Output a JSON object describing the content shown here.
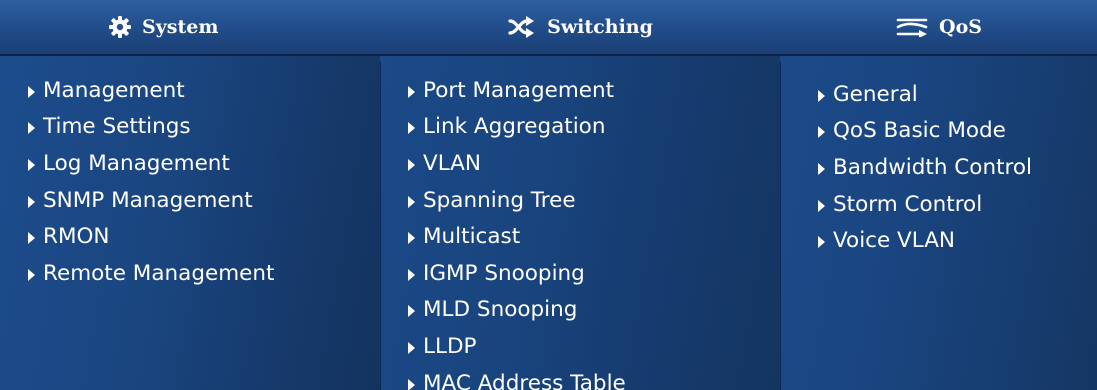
{
  "system": {
    "label": "System",
    "icon": "gear-icon",
    "items": [
      {
        "label": "Management"
      },
      {
        "label": "Time Settings"
      },
      {
        "label": "Log Management"
      },
      {
        "label": "SNMP Management"
      },
      {
        "label": "RMON"
      },
      {
        "label": "Remote Management"
      }
    ]
  },
  "switching": {
    "label": "Switching",
    "icon": "crossing-arrows-icon",
    "items": [
      {
        "label": "Port Management"
      },
      {
        "label": "Link Aggregation"
      },
      {
        "label": "VLAN"
      },
      {
        "label": "Spanning Tree"
      },
      {
        "label": "Multicast"
      },
      {
        "label": "IGMP Snooping"
      },
      {
        "label": "MLD Snooping"
      },
      {
        "label": "LLDP"
      },
      {
        "label": "MAC Address Table"
      }
    ]
  },
  "qos": {
    "label": "QoS",
    "icon": "qos-lines-icon",
    "items": [
      {
        "label": "General"
      },
      {
        "label": "QoS Basic Mode"
      },
      {
        "label": "Bandwidth Control"
      },
      {
        "label": "Storm Control"
      },
      {
        "label": "Voice VLAN"
      }
    ]
  },
  "colors": {
    "menu_background": "#1a457f",
    "header_background": "#234f8d",
    "text": "#ffffff"
  }
}
